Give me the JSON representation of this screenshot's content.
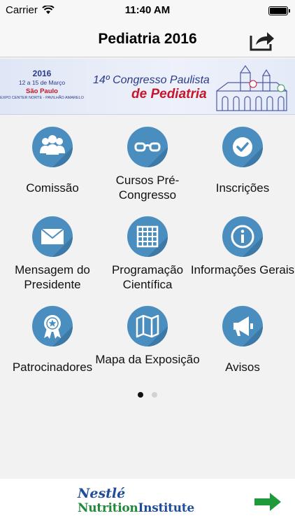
{
  "status_bar": {
    "carrier": "Carrier",
    "time": "11:40 AM"
  },
  "nav": {
    "title": "Pediatria 2016"
  },
  "banner": {
    "year": "2016",
    "dates": "12 a 15 de Março",
    "city": "São Paulo",
    "venue": "EXPO CENTER NORTE - PAVILHÃO AMARELO",
    "title": "14º Congresso Paulista",
    "subtitle": "de Pediatria"
  },
  "menu": [
    {
      "label": "Comissão",
      "icon": "people-icon"
    },
    {
      "label": "Cursos Pré-Congresso",
      "icon": "glasses-icon"
    },
    {
      "label": "Inscrições",
      "icon": "checkmark-icon"
    },
    {
      "label": "Mensagem do Presidente",
      "icon": "envelope-icon"
    },
    {
      "label": "Programação Científica",
      "icon": "calendar-grid-icon"
    },
    {
      "label": "Informações Gerais",
      "icon": "info-icon"
    },
    {
      "label": "Patrocinadores",
      "icon": "award-ribbon-icon"
    },
    {
      "label": "Mapa da Exposição",
      "icon": "map-icon"
    },
    {
      "label": "Avisos",
      "icon": "megaphone-icon"
    }
  ],
  "pager": {
    "total": 2,
    "current": 1
  },
  "ad": {
    "brand_line1": "Nestlé",
    "brand_line2_a": "Nutrition",
    "brand_line2_b": "Institute"
  },
  "colors": {
    "icon_circle": "#4a8dbf",
    "icon_shade": "#3d79a6",
    "arrow": "#1f9a3b"
  }
}
